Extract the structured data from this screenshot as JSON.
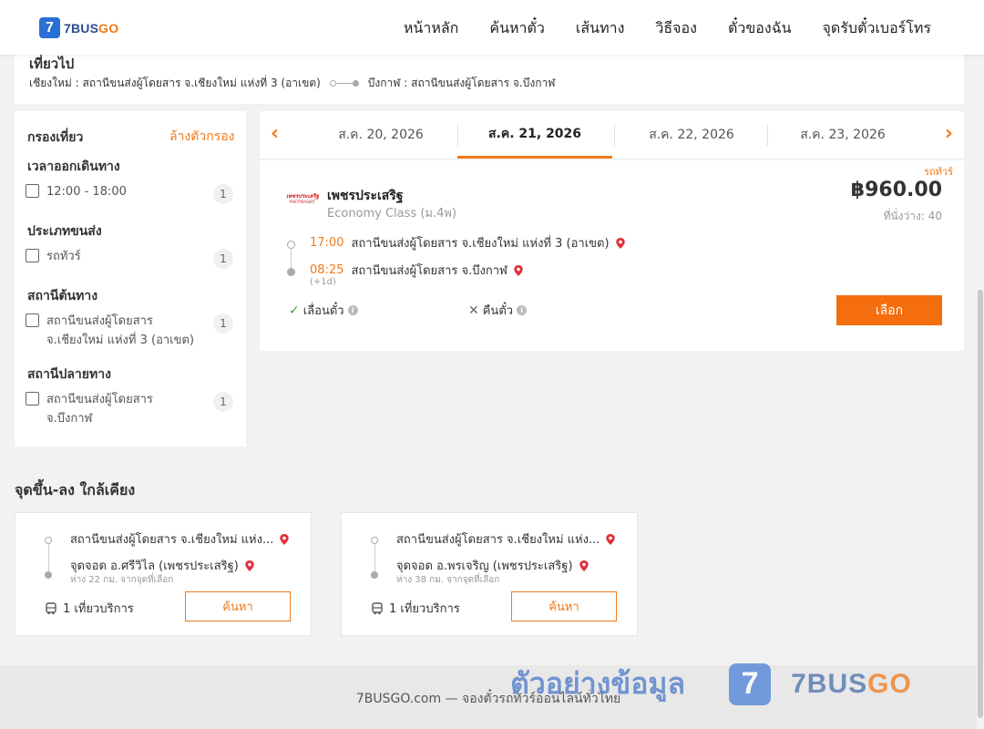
{
  "header": {
    "logo_mark": "7",
    "logo_brand": "7BUS",
    "logo_brand_accent": "GO",
    "nav": [
      "หน้าหลัก",
      "ค้นหาตั๋ว",
      "เส้นทาง",
      "วิธีจอง",
      "ตั๋วของฉัน",
      "จุดรับตั๋วเบอร์โทร"
    ]
  },
  "route": {
    "title": "เที่ยวไป",
    "from": "เชียงใหม่ : สถานีขนส่งผู้โดยสาร จ.เชียงใหม่ แห่งที่ 3 (อาเขต)",
    "to": "บึงกาฬ : สถานีขนส่งผู้โดยสาร จ.บึงกาฬ"
  },
  "filters": {
    "title": "กรองเที่ยว",
    "clear": "ล้างตัวกรอง",
    "groups": [
      {
        "title": "เวลาออกเดินทาง",
        "items": [
          {
            "label": "12:00 - 18:00",
            "count": "1"
          }
        ]
      },
      {
        "title": "ประเภทขนส่ง",
        "items": [
          {
            "label": "รถทัวร์",
            "count": "1"
          }
        ]
      },
      {
        "title": "สถานีต้นทาง",
        "items": [
          {
            "label": "สถานีขนส่งผู้โดยสาร จ.เชียงใหม่ แห่งที่ 3 (อาเขต)",
            "count": "1"
          }
        ]
      },
      {
        "title": "สถานีปลายทาง",
        "items": [
          {
            "label": "สถานีขนส่งผู้โดยสาร จ.บึงกาฬ",
            "count": "1"
          }
        ]
      }
    ]
  },
  "dates": {
    "prev": "‹",
    "next": "›",
    "items": [
      "ส.ค. 20, 2026",
      "ส.ค. 21, 2026",
      "ส.ค. 22, 2026",
      "ส.ค. 23, 2026"
    ],
    "active": "ส.ค. 21, 2026"
  },
  "trip": {
    "bus_type": "รถทัวร์",
    "operator_logo_line1": "เพชรประเสริฐ",
    "operator_logo_line2": "PHETPRASERT",
    "operator": "เพชรประเสริฐ",
    "class": "Economy Class (ม.4พ)",
    "price": "฿960.00",
    "seats": "ที่นั่งว่าง: 40",
    "depart_time": "17:00",
    "depart_station": "สถานีขนส่งผู้โดยสาร จ.เชียงใหม่ แห่งที่ 3 (อาเขต)",
    "arrive_time": "08:25",
    "arrive_station": "สถานีขนส่งผู้โดยสาร จ.บึงกาฬ",
    "plus_day": "(+1d)",
    "reschedule": "เลื่อนตั๋ว",
    "refund": "คืนตั๋ว",
    "select": "เลือก"
  },
  "nearby": {
    "title": "จุดขึ้น-ลง ใกล้เคียง",
    "cards": [
      {
        "from": "สถานีขนส่งผู้โดยสาร จ.เชียงใหม่ แห่ง...",
        "to": "จุดจอด อ.ศรีวิไล (เพชรประเสริฐ)",
        "distance": "ห่าง 22 กม. จากจุดที่เลือก",
        "trips": "1 เที่ยวบริการ",
        "search": "ค้นหา"
      },
      {
        "from": "สถานีขนส่งผู้โดยสาร จ.เชียงใหม่ แห่ง...",
        "to": "จุดจอด อ.พรเจริญ (เพชรประเสริฐ)",
        "distance": "ห่าง 38 กม. จากจุดที่เลือก",
        "trips": "1 เที่ยวบริการ",
        "search": "ค้นหา"
      }
    ]
  },
  "footer": {
    "text": "7BUSGO.com — จองตั๋วรถทัวร์ออนไลน์ทั่วไทย"
  },
  "watermark": {
    "text": "ตัวอย่างข้อมูล",
    "mark": "7",
    "brand": "7BUS",
    "brand_accent": "GO"
  },
  "colors": {
    "accent": "#f07a1a",
    "brand_blue": "#2a6fd6",
    "button": "#f46d0e"
  }
}
